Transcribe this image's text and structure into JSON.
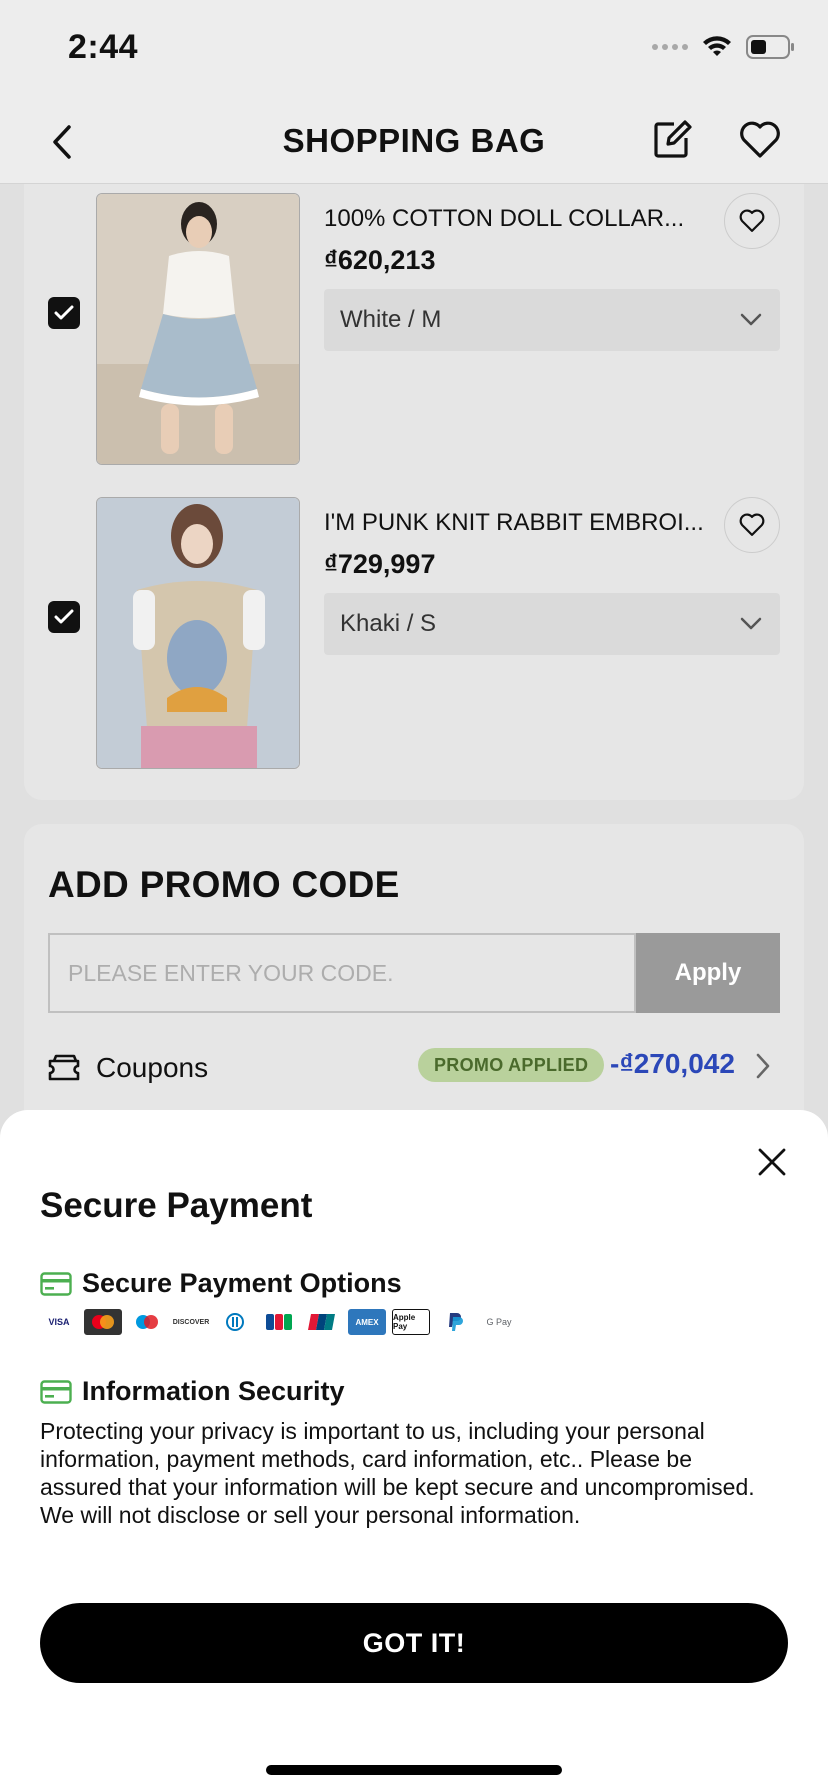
{
  "status_bar": {
    "time": "2:44"
  },
  "nav": {
    "title": "SHOPPING BAG"
  },
  "items": [
    {
      "name": "100% COTTON DOLL COLLAR...",
      "price": "₫620,213",
      "option": "White / M",
      "checked": true,
      "image": "white-top-blue-skirt-photo"
    },
    {
      "name": "I'M PUNK KNIT RABBIT EMBROI...",
      "price": "₫729,997",
      "option": "Khaki / S",
      "checked": true,
      "image": "khaki-knit-vest-photo"
    }
  ],
  "promo": {
    "title": "ADD PROMO CODE",
    "placeholder": "PLEASE ENTER YOUR CODE.",
    "apply_label": "Apply",
    "coupons_label": "Coupons",
    "badge": "PROMO APPLIED",
    "amount": "-₫270,042"
  },
  "sheet": {
    "title": "Secure Payment",
    "payment_options_title": "Secure Payment Options",
    "payment_icons": [
      "VISA",
      "mastercard",
      "maestro",
      "DISCOVER",
      "diners-club",
      "JCB",
      "unionpay",
      "AMEX",
      "Apple Pay",
      "PayPal",
      "G Pay"
    ],
    "security_title": "Information Security",
    "security_text": "Protecting your privacy is important to us, including your personal information, payment methods, card information, etc.. Please be assured that your information will be kept secure and uncompromised. We will not disclose or sell your personal information.",
    "button_label": "GOT IT!"
  },
  "colors": {
    "accent_blue": "#2b47b8",
    "promo_badge_bg": "#b9d19c",
    "promo_badge_text": "#4a6a2c",
    "secure_green": "#4caf50"
  }
}
